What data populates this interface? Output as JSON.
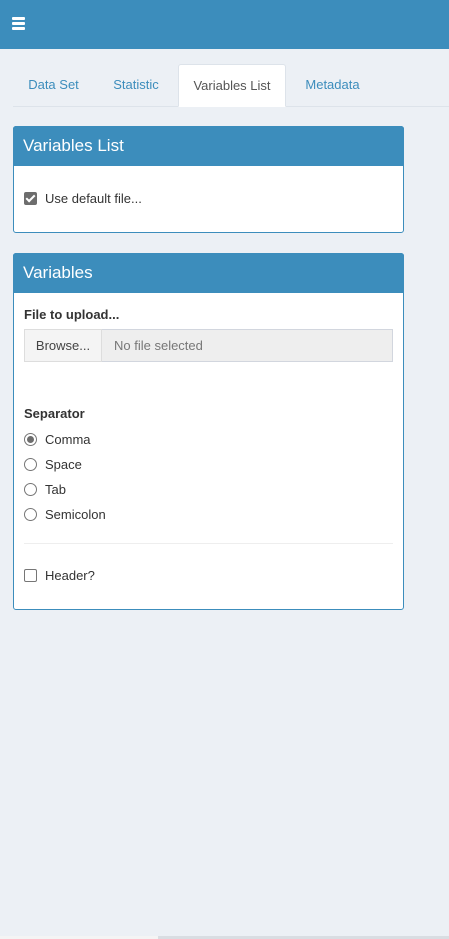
{
  "header": {
    "menu_icon": "hamburger-icon",
    "color": "#3c8dbc"
  },
  "tabs": [
    {
      "label": "Data Set",
      "active": false
    },
    {
      "label": "Statistic",
      "active": false
    },
    {
      "label": "Variables List",
      "active": true
    },
    {
      "label": "Metadata",
      "active": false
    }
  ],
  "variables_list_box": {
    "title": "Variables List",
    "use_default": {
      "label": "Use default file...",
      "checked": true
    }
  },
  "variables_box": {
    "title": "Variables",
    "file_label": "File to upload...",
    "browse_label": "Browse...",
    "file_placeholder": "No file selected",
    "separator_label": "Separator",
    "separator_options": [
      {
        "label": "Comma",
        "checked": true
      },
      {
        "label": "Space",
        "checked": false
      },
      {
        "label": "Tab",
        "checked": false
      },
      {
        "label": "Semicolon",
        "checked": false
      }
    ],
    "header_option": {
      "label": "Header?",
      "checked": false
    }
  }
}
